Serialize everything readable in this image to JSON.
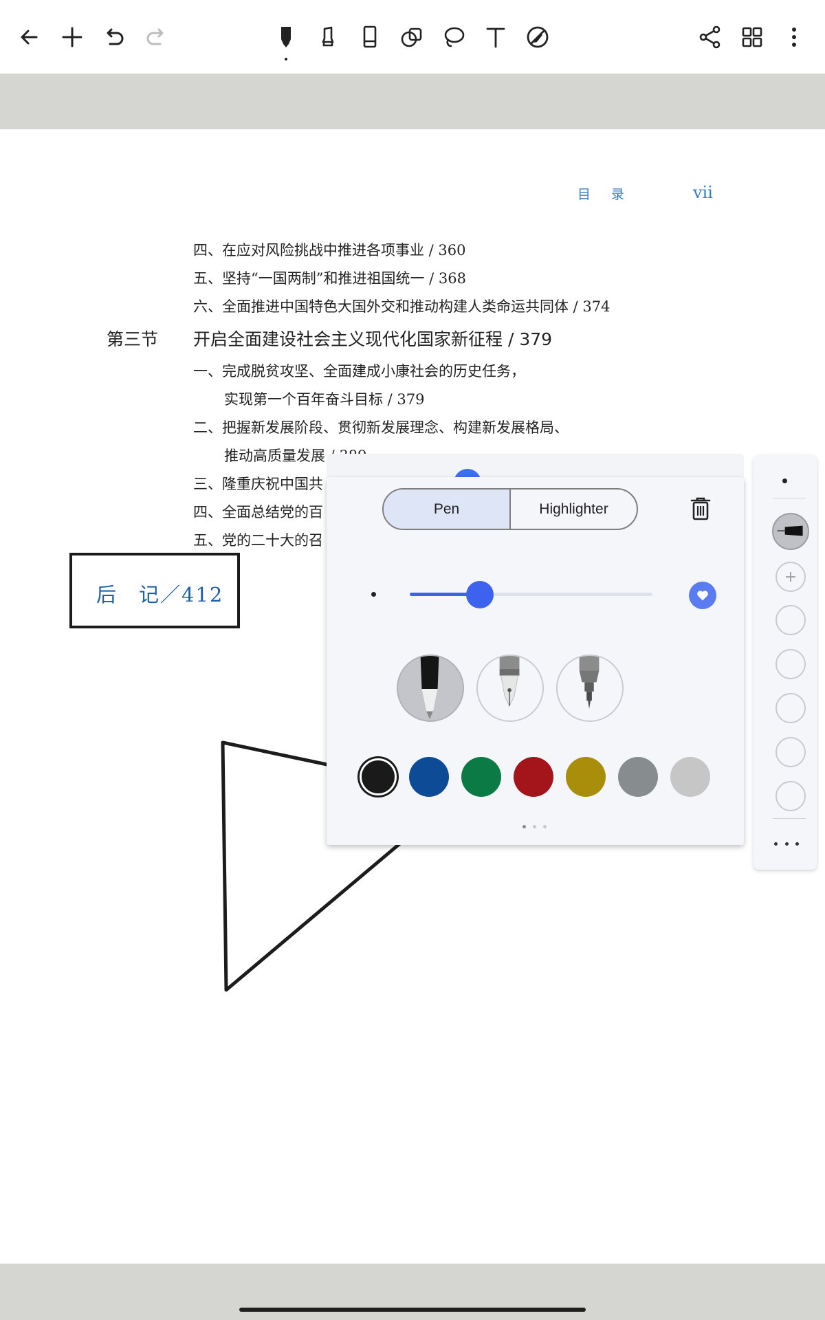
{
  "toolbar": {
    "left": [
      {
        "name": "back-icon"
      },
      {
        "name": "add-icon"
      },
      {
        "name": "undo-icon"
      },
      {
        "name": "redo-icon"
      }
    ],
    "tools": [
      {
        "name": "pen-tool-icon",
        "active": true
      },
      {
        "name": "highlighter-tool-icon"
      },
      {
        "name": "eraser-tool-icon"
      },
      {
        "name": "shape-tool-icon"
      },
      {
        "name": "lasso-tool-icon"
      },
      {
        "name": "text-tool-icon"
      },
      {
        "name": "disable-pen-icon"
      }
    ],
    "right": [
      {
        "name": "share-icon"
      },
      {
        "name": "grid-view-icon"
      },
      {
        "name": "more-vertical-icon"
      }
    ]
  },
  "document": {
    "running_head": "目 录",
    "page_number": "vii",
    "toc": [
      "四、在应对风险挑战中推进各项事业 / 360",
      "五、坚持“一国两制”和推进祖国统一 / 368",
      "六、全面推进中国特色大国外交和推动构建人类命运共同体 / 374",
      "开启全面建设社会主义现代化国家新征程 / 379",
      "一、完成脱贫攻坚、全面建成小康社会的历史任务，",
      "实现第一个百年奋斗目标 / 379",
      "二、把握新发展阶段、贯彻新发展理念、构建新发展格局、",
      "推动高质量发展 / 389",
      "三、隆重庆祝中国共",
      "四、全面总结党的百",
      "五、党的二十大的召"
    ],
    "section_label": "第三节",
    "postscript": "后　记／412"
  },
  "pen_settings": {
    "tabs": [
      "Pen",
      "Highlighter"
    ],
    "active_tab": "Pen",
    "size_fraction": 0.29,
    "nibs": [
      {
        "name": "ballpoint-nib-icon",
        "selected": true
      },
      {
        "name": "fountain-pen-nib-icon"
      },
      {
        "name": "technical-pen-nib-icon"
      }
    ],
    "colors": [
      "#1a1a1a",
      "#0d4b96",
      "#0c7a45",
      "#a3141b",
      "#a88e0b",
      "#878d8f",
      "#c6c6c6"
    ],
    "selected_color": "#1a1a1a",
    "accent": "#3d63ee",
    "page_count": 3,
    "current_page": 1
  },
  "pen_rail": {
    "slots": 5
  }
}
